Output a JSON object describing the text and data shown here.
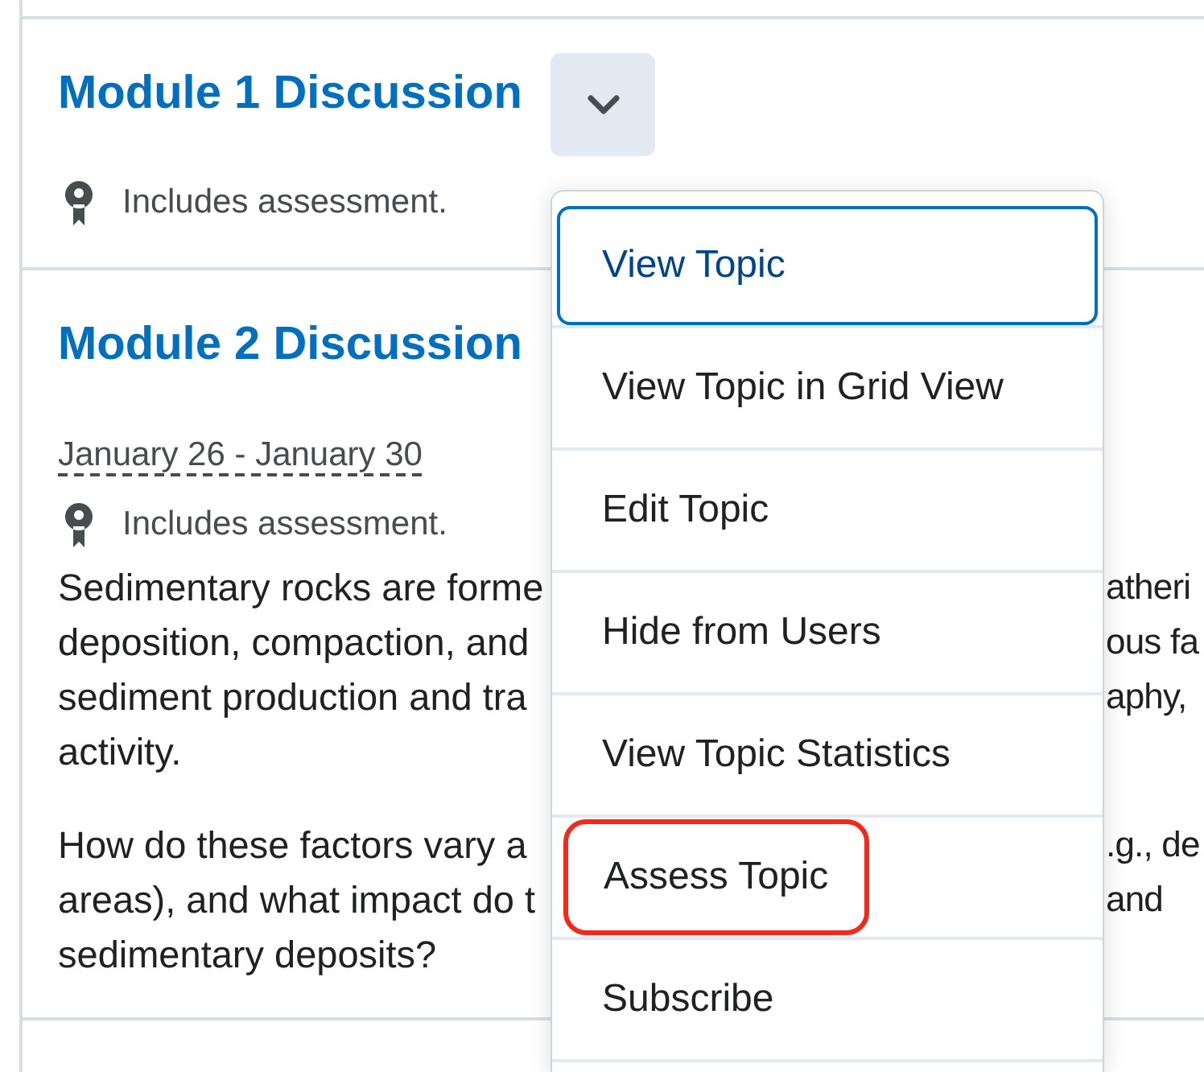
{
  "modules": [
    {
      "title": "Module 1 Discussion",
      "menu_button": {
        "expanded": true
      },
      "assessment_note": "Includes assessment."
    },
    {
      "title": "Module 2 Discussion",
      "dates": "January 26 - January 30",
      "assessment_note": "Includes assessment.",
      "description": [
        [
          {
            "left": "Sedimentary rocks are forme",
            "right": "atheri"
          },
          {
            "left": "deposition, compaction, and",
            "right": "ous fa"
          },
          {
            "left": "sediment production and tra",
            "right": "aphy,"
          },
          {
            "left": "activity."
          }
        ],
        [
          {
            "left": "How do these factors vary a",
            "right": ".g., de"
          },
          {
            "left": "areas), and what impact do t",
            "right": "and"
          },
          {
            "left": "sedimentary deposits?"
          }
        ]
      ]
    }
  ],
  "menu": {
    "items": [
      {
        "label": "View Topic",
        "selected": true,
        "highlighted": false
      },
      {
        "label": "View Topic in Grid View",
        "selected": false,
        "highlighted": false
      },
      {
        "label": "Edit Topic",
        "selected": false,
        "highlighted": false
      },
      {
        "label": "Hide from Users",
        "selected": false,
        "highlighted": false
      },
      {
        "label": "View Topic Statistics",
        "selected": false,
        "highlighted": false
      },
      {
        "label": "Assess Topic",
        "selected": false,
        "highlighted": true
      },
      {
        "label": "Subscribe",
        "selected": false,
        "highlighted": false
      }
    ]
  }
}
